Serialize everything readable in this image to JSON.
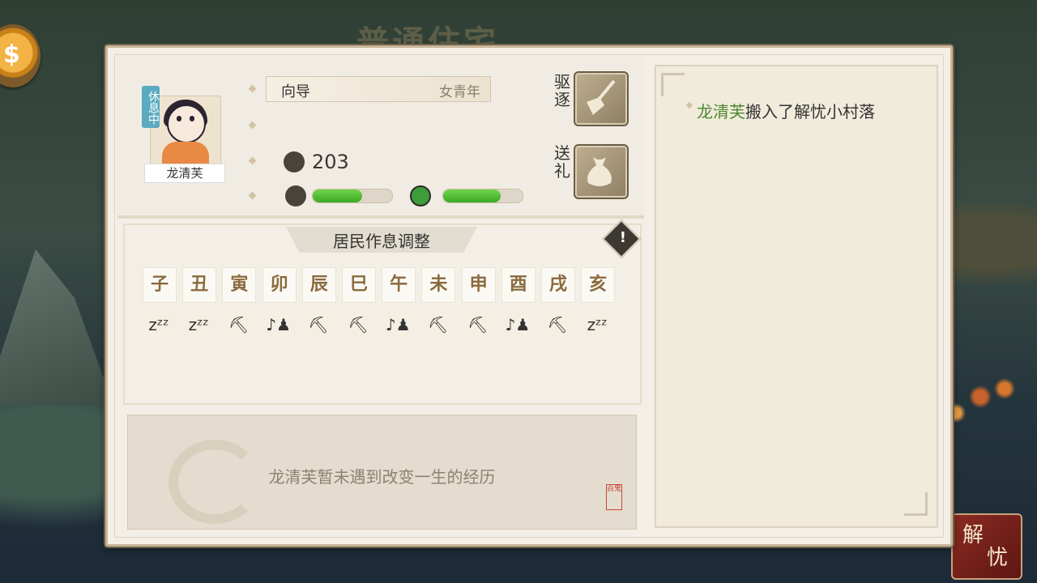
{
  "background": {
    "title_ghost": "普通住宅"
  },
  "hud": {
    "jieyou_label_1": "解",
    "jieyou_label_2": "忧"
  },
  "resident": {
    "status": "休息中",
    "name": "龙清芙",
    "role": "向导",
    "age_group": "女青年",
    "stat_value": "203",
    "heart_bar": 0.62,
    "spirit_bar": 0.72
  },
  "actions": {
    "expel_label": "驱逐",
    "gift_label": "送礼"
  },
  "schedule": {
    "title": "居民作息调整",
    "warning_glyph": "!",
    "hours": [
      "子",
      "丑",
      "寅",
      "卯",
      "辰",
      "巳",
      "午",
      "未",
      "申",
      "酉",
      "戌",
      "亥"
    ],
    "activities": [
      "sleep",
      "sleep",
      "work",
      "leisure",
      "work",
      "work",
      "leisure",
      "work",
      "work",
      "leisure",
      "work",
      "sleep"
    ]
  },
  "story": {
    "text": "龙清芙暂未遇到改变一生的经历",
    "seal": "百鬼"
  },
  "log": {
    "entries": [
      {
        "who": "龙清芙",
        "text": "搬入了解忧小村落"
      }
    ]
  },
  "colors": {
    "bar_fill": "#4fbd33",
    "name_highlight": "#4b8a2f",
    "hour_text": "#8a6a3e",
    "panel_bg": "#f3efe6"
  }
}
